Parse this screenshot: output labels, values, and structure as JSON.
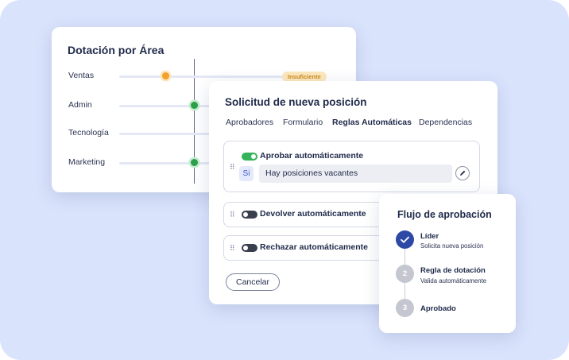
{
  "staffing_card": {
    "title": "Dotación por Área",
    "rows": [
      {
        "label": "Ventas",
        "level": 0.22,
        "status": "orange",
        "badge": "Insuficiente"
      },
      {
        "label": "Admin",
        "level": 0.36,
        "status": "green"
      },
      {
        "label": "Tecnología",
        "level": null,
        "status": "none"
      },
      {
        "label": "Marketing",
        "level": 0.36,
        "status": "green"
      }
    ]
  },
  "request_card": {
    "title": "Solicitud de nueva posición",
    "tabs": [
      {
        "label": "Aprobadores",
        "active": false
      },
      {
        "label": "Formulario",
        "active": false
      },
      {
        "label": "Reglas Automáticas",
        "active": true
      },
      {
        "label": "Dependencias",
        "active": false
      }
    ],
    "rules": [
      {
        "label": "Aprobar automáticamente",
        "enabled": true,
        "condition_operator": "Si",
        "condition_value": "Hay posiciones vacantes"
      },
      {
        "label": "Devolver automáticamente",
        "enabled": false
      },
      {
        "label": "Rechazar automáticamente",
        "enabled": false
      }
    ],
    "cancel_label": "Cancelar"
  },
  "flow_card": {
    "title": "Flujo de aprobación",
    "steps": [
      {
        "marker": "",
        "name": "Líder",
        "subtitle": "Solicita nueva posición",
        "done": true
      },
      {
        "marker": "2",
        "name": "Regla de dotación",
        "subtitle": "Valida automáticamente",
        "done": false
      },
      {
        "marker": "3",
        "name": "Aprobado",
        "subtitle": "",
        "done": false
      }
    ]
  },
  "colors": {
    "background": "#dae3fc",
    "accent": "#2e48a5",
    "toggle_on": "#34b35a",
    "status_warning": "#f0a22a",
    "status_ok": "#2aa14a"
  },
  "icons": [
    "drag-handle-icon",
    "pencil-icon",
    "check-icon"
  ]
}
